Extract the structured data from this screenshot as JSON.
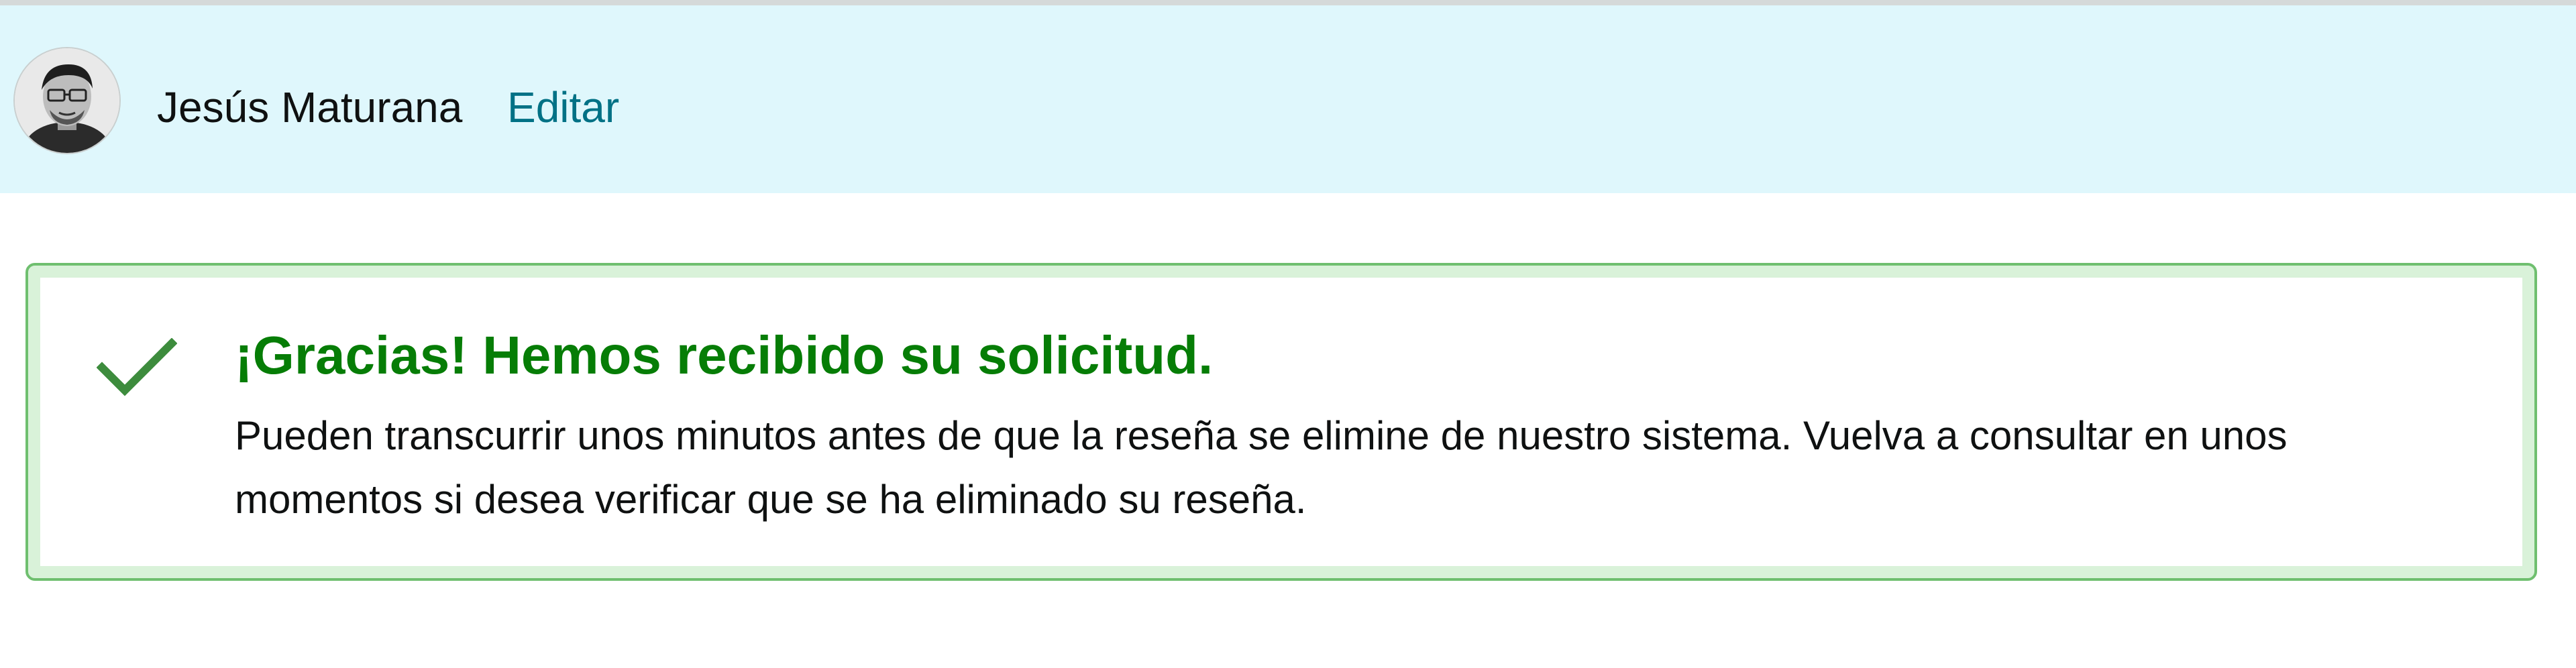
{
  "header": {
    "user_name": "Jesús Maturana",
    "edit_label": "Editar",
    "avatar_icon": "user-avatar-icon",
    "background_color": "#dff7fc",
    "link_color": "#007185"
  },
  "alert": {
    "status": "success",
    "icon": "checkmark-icon",
    "title": "¡Gracias! Hemos recibido su solicitud.",
    "message": "Pueden transcurrir unos minutos antes de que la reseña se elimine de nuestro sistema. Vuelva a consultar en unos momentos si desea verificar que se ha eliminado su reseña.",
    "accent_color": "#067d06",
    "border_color": "#6fbf6f"
  }
}
